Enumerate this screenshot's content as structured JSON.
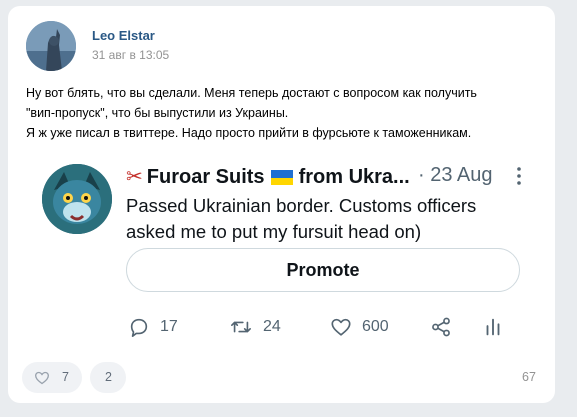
{
  "post": {
    "author": "Leo Elstar",
    "date": "31 авг в 13:05",
    "text_lines": [
      "Ну вот блять, что вы сделали. Меня теперь достают с вопросом как получить",
      "\"вип-пропуск\", что бы выпустили из Украины.",
      "Я ж уже писал в твиттере. Надо просто прийти в фурсьюте к таможенникам."
    ]
  },
  "tweet": {
    "author": "Furoar Suits",
    "author_suffix": "from Ukra...",
    "date": "· 23 Aug",
    "text": "Passed Ukrainian border. Customs officers asked me to put my fursuit head on)",
    "promote_label": "Promote",
    "replies": "17",
    "retweets": "24",
    "likes": "600",
    "icons": [
      "scissors-icon",
      "ukraine-flag-icon",
      "more-icon",
      "reply-icon",
      "retweet-icon",
      "like-icon",
      "share-icon",
      "analytics-icon"
    ]
  },
  "footer": {
    "likes_count": "7",
    "comments_count": "2",
    "views": "67"
  },
  "colors": {
    "link": "#2a5885",
    "muted": "#939393",
    "tweet_muted": "#536471",
    "page_bg": "#e9ecef"
  }
}
